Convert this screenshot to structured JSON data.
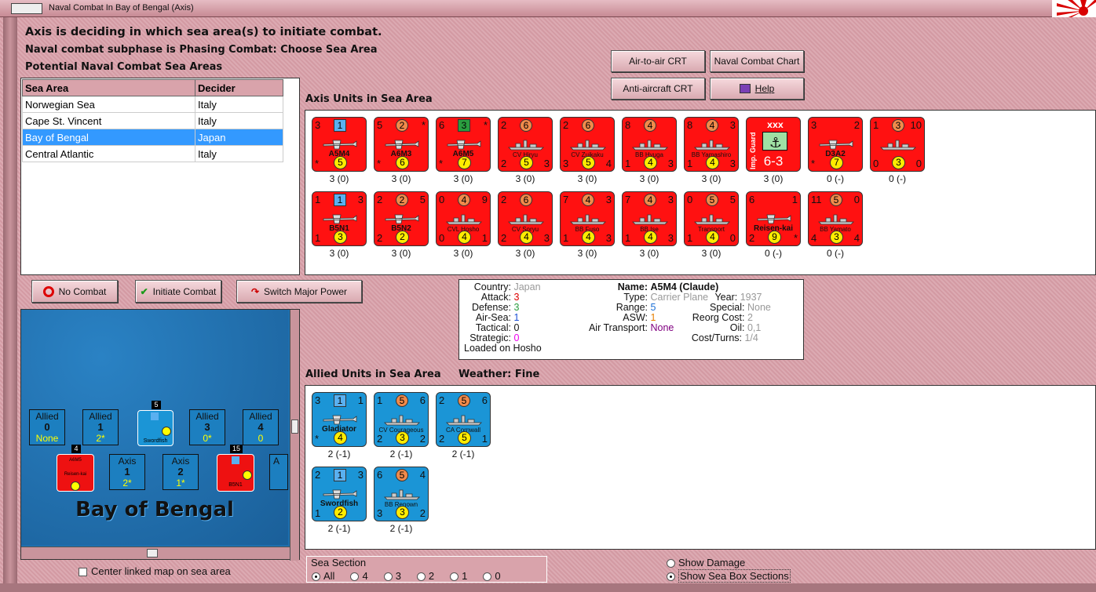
{
  "window": {
    "title": "Naval Combat In Bay of Bengal (Axis)"
  },
  "header": {
    "line1": "Axis is deciding in which sea area(s) to initiate combat.",
    "line2": "Naval combat subphase is Phasing Combat: Choose Sea Area",
    "line3": "Potential Naval Combat Sea Areas"
  },
  "buttons": {
    "air_to_air": "Air-to-air CRT",
    "naval_chart": "Naval Combat Chart",
    "anti_aircraft": "Anti-aircraft CRT",
    "help": "Help",
    "no_combat": "No Combat",
    "initiate": "Initiate Combat",
    "switch": "Switch Major Power"
  },
  "sea_table": {
    "headers": [
      "Sea Area",
      "Decider"
    ],
    "rows": [
      [
        "Norwegian Sea",
        "Italy"
      ],
      [
        "Cape St. Vincent",
        "Italy"
      ],
      [
        "Bay of Bengal",
        "Japan"
      ],
      [
        "Central Atlantic",
        "Italy"
      ]
    ],
    "selected_row": 2
  },
  "axis_label": "Axis Units in Sea Area",
  "allied_label": "Allied Units in Sea Area",
  "weather_label": "Weather:  Fine",
  "axis_units": [
    {
      "tl": "3",
      "tr": "",
      "att": "1",
      "att_style": "sq",
      "bl": "*",
      "br": "",
      "def": "5",
      "name": "A5M4",
      "type": "plane",
      "label": "3 (0)"
    },
    {
      "tl": "5",
      "tr": "*",
      "att": "2",
      "att_style": "or",
      "bl": "*",
      "br": "",
      "def": "6",
      "name": "A6M3",
      "type": "plane",
      "label": "3 (0)"
    },
    {
      "tl": "6",
      "tr": "*",
      "att": "3",
      "att_style": "gr",
      "bl": "*",
      "br": "",
      "def": "7",
      "name": "A6M5",
      "type": "plane",
      "label": "3 (0)"
    },
    {
      "tl": "2",
      "tr": "",
      "att": "6",
      "att_style": "circ",
      "bl": "2",
      "br": "3",
      "def": "5",
      "name": "CV Hiryu",
      "type": "ship",
      "label": "3 (0)"
    },
    {
      "tl": "2",
      "tr": "",
      "att": "6",
      "att_style": "circ",
      "bl": "3",
      "br": "4",
      "def": "5",
      "name": "CV Zuikaku",
      "type": "ship",
      "label": "3 (0)"
    },
    {
      "tl": "8",
      "tr": "",
      "att": "4",
      "att_style": "circ",
      "bl": "1",
      "br": "3",
      "def": "4",
      "name": "BB Hyuga",
      "type": "ship",
      "label": "3 (0)"
    },
    {
      "tl": "8",
      "tr": "3",
      "att": "4",
      "att_style": "circ",
      "bl": "1",
      "br": "3",
      "def": "4",
      "name": "BB Yamashiro",
      "type": "ship",
      "label": "3 (0)"
    },
    {
      "tl": "",
      "tr": "",
      "att": "",
      "att_style": "none",
      "bl": "",
      "br": "",
      "def": "",
      "name": "6-3",
      "type": "marine",
      "label": "3 (0)"
    },
    {
      "tl": "3",
      "tr": "2",
      "att": "",
      "att_style": "none",
      "bl": "*",
      "br": "",
      "def": "7",
      "name": "D3A2",
      "type": "plane",
      "label": "0 (-)"
    },
    {
      "tl": "1",
      "tr": "10",
      "att": "3",
      "att_style": "circ",
      "bl": "0",
      "br": "0",
      "def": "3",
      "name": "",
      "type": "ship",
      "label": "0 (-)"
    },
    {
      "tl": "1",
      "tr": "3",
      "att": "1",
      "att_style": "sq",
      "bl": "1",
      "br": "",
      "def": "3",
      "name": "B5N1",
      "type": "plane",
      "label": "3 (0)"
    },
    {
      "tl": "2",
      "tr": "5",
      "att": "2",
      "att_style": "or",
      "bl": "2",
      "br": "",
      "def": "2",
      "name": "B5N2",
      "type": "plane",
      "label": "3 (0)"
    },
    {
      "tl": "0",
      "tr": "9",
      "att": "4",
      "att_style": "circ",
      "bl": "0",
      "br": "1",
      "def": "4",
      "name": "CVL Hosho",
      "type": "ship",
      "label": "3 (0)"
    },
    {
      "tl": "2",
      "tr": "",
      "att": "6",
      "att_style": "circ",
      "bl": "2",
      "br": "3",
      "def": "4",
      "name": "CV Soryu",
      "type": "ship",
      "label": "3 (0)"
    },
    {
      "tl": "7",
      "tr": "3",
      "att": "4",
      "att_style": "circ",
      "bl": "1",
      "br": "3",
      "def": "4",
      "name": "BB Fuso",
      "type": "ship",
      "label": "3 (0)"
    },
    {
      "tl": "7",
      "tr": "3",
      "att": "4",
      "att_style": "circ",
      "bl": "1",
      "br": "3",
      "def": "4",
      "name": "BB Ise",
      "type": "ship",
      "label": "3 (0)"
    },
    {
      "tl": "0",
      "tr": "5",
      "att": "5",
      "att_style": "circ",
      "bl": "1",
      "br": "0",
      "def": "4",
      "name": "Transport",
      "type": "ship",
      "label": "3 (0)"
    },
    {
      "tl": "6",
      "tr": "1",
      "att": "",
      "att_style": "none",
      "bl": "2",
      "br": "*",
      "def": "9",
      "name": "Reisen-kai",
      "type": "plane",
      "label": "0 (-)"
    },
    {
      "tl": "11",
      "tr": "0",
      "att": "5",
      "att_style": "circ",
      "bl": "4",
      "br": "4",
      "def": "3",
      "name": "BB Yamato",
      "type": "ship",
      "label": "0 (-)"
    }
  ],
  "allied_units": [
    {
      "tl": "3",
      "tr": "1",
      "att": "1",
      "att_style": "sq",
      "bl": "*",
      "br": "",
      "def": "4",
      "name": "Gladiator",
      "type": "plane",
      "label": "2 (-1)"
    },
    {
      "tl": "1",
      "tr": "6",
      "att": "5",
      "att_style": "circ",
      "bl": "2",
      "br": "2",
      "def": "3",
      "name": "CV Courageous",
      "type": "ship",
      "label": "2 (-1)"
    },
    {
      "tl": "2",
      "tr": "6",
      "att": "5",
      "att_style": "circ",
      "bl": "2",
      "br": "1",
      "def": "5",
      "name": "CA Cornwall",
      "type": "ship",
      "label": "2 (-1)"
    },
    {
      "tl": "2",
      "tr": "3",
      "att": "1",
      "att_style": "sq",
      "bl": "1",
      "br": "",
      "def": "2",
      "name": "Swordfish",
      "type": "plane",
      "label": "2 (-1)"
    },
    {
      "tl": "6",
      "tr": "4",
      "att": "5",
      "att_style": "circ",
      "bl": "3",
      "br": "2",
      "def": "3",
      "name": "BB Renown",
      "type": "ship",
      "label": "2 (-1)"
    }
  ],
  "info": {
    "country_l": "Country:",
    "country": "Japan",
    "attack_l": "Attack:",
    "attack": "3",
    "defense_l": "Defense:",
    "defense": "3",
    "airsea_l": "Air-Sea:",
    "airsea": "1",
    "tactical_l": "Tactical:",
    "tactical": "0",
    "strategic_l": "Strategic:",
    "strategic": "0",
    "loaded": "Loaded on Hosho",
    "name_l": "Name:",
    "name": "A5M4 (Claude)",
    "type_l": "Type:",
    "type": "Carrier Plane",
    "year_l": "Year:",
    "year": "1937",
    "range_l": "Range:",
    "range": "5",
    "special_l": "Special:",
    "special": "None",
    "asw_l": "ASW:",
    "asw": "1",
    "reorg_l": "Reorg Cost:",
    "reorg": "2",
    "airtrans_l": "Air Transport:",
    "airtrans": "None",
    "oil_l": "Oil:",
    "oil": "0,1",
    "cost_l": "Cost/Turns:",
    "cost": "1/4"
  },
  "map": {
    "title": "Bay of Bengal",
    "boxes": [
      {
        "side": "Allied",
        "num": "0",
        "sub": "None"
      },
      {
        "side": "Allied",
        "num": "1",
        "sub": "2*"
      },
      {
        "side": "Allied",
        "num": "3",
        "sub": "0*"
      },
      {
        "side": "Allied",
        "num": "4",
        "sub": "0"
      },
      {
        "side": "Axis",
        "num": "1",
        "sub": "2*"
      },
      {
        "side": "Axis",
        "num": "2",
        "sub": "1*"
      }
    ],
    "stack_counts": [
      "5",
      "4",
      "15"
    ],
    "unit_names": [
      "Swordfish",
      "A6M5",
      "B5N1"
    ],
    "unit_sub": "Reisen-kai",
    "partial": "A"
  },
  "center_link": "Center linked map on sea area",
  "sea_section": {
    "title": "Sea Section",
    "options": [
      "All",
      "4",
      "3",
      "2",
      "1",
      "0"
    ],
    "selected": "All"
  },
  "show": {
    "damage": "Show Damage",
    "boxes": "Show Sea Box Sections"
  }
}
